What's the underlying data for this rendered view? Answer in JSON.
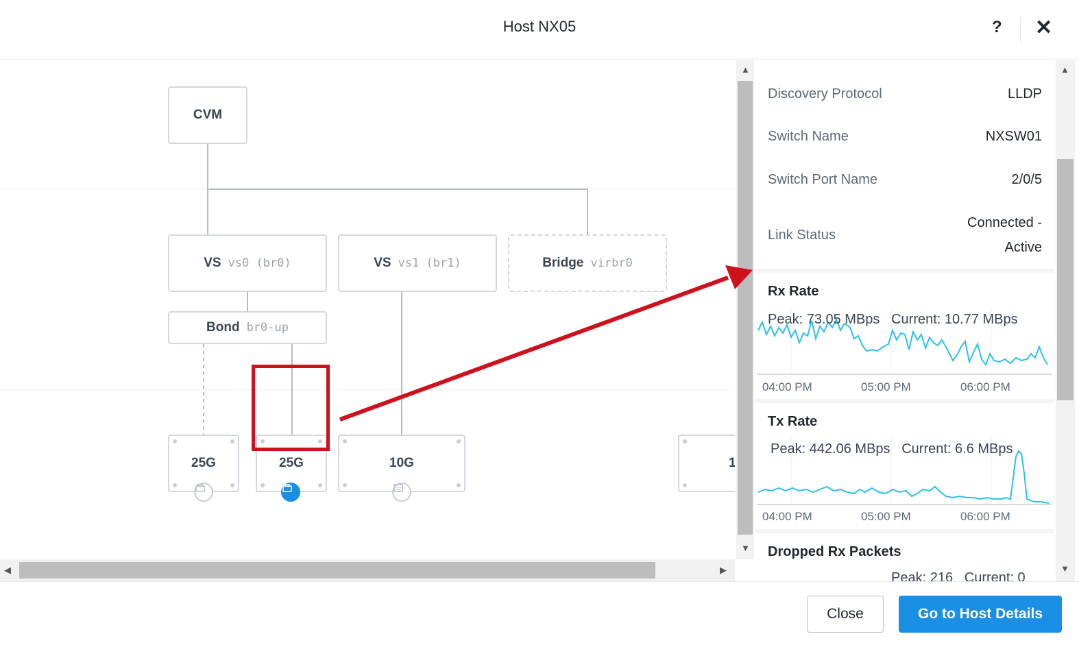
{
  "header": {
    "title": "Host NX05",
    "help_glyph": "?",
    "close_glyph": "✕"
  },
  "diagram": {
    "cvm": "CVM",
    "switches": [
      {
        "type": "VS",
        "name": "vs0 (br0)"
      },
      {
        "type": "VS",
        "name": "vs1 (br1)"
      },
      {
        "type": "Bridge",
        "name": "virbr0"
      }
    ],
    "bond": {
      "type": "Bond",
      "name": "br0-up"
    },
    "ports": [
      {
        "speed": "25G",
        "icon": "ethernet-icon",
        "active": false
      },
      {
        "speed": "25G",
        "icon": "ethernet-icon",
        "active": true
      },
      {
        "speed": "10G",
        "icon": "nic-icon",
        "active": false
      },
      {
        "speed": "1",
        "icon": "ethernet-icon",
        "active": false
      }
    ]
  },
  "details": {
    "rows": [
      {
        "label": "Discovery Protocol",
        "value": "LLDP"
      },
      {
        "label": "Switch Name",
        "value": "NXSW01"
      },
      {
        "label": "Switch Port Name",
        "value": "2/0/5"
      },
      {
        "label": "Link Status",
        "value_line1": "Connected -",
        "value_line2": "Active"
      }
    ],
    "charts": [
      {
        "title": "Rx Rate",
        "peak": "Peak: 73.05 MBps",
        "current": "Current: 10.77 MBps",
        "xticks": [
          "04:00 PM",
          "05:00 PM",
          "06:00 PM"
        ]
      },
      {
        "title": "Tx Rate",
        "peak": "Peak: 442.06 MBps",
        "current": "Current: 6.6 MBps",
        "xticks": [
          "04:00 PM",
          "05:00 PM",
          "06:00 PM"
        ]
      },
      {
        "title": "Dropped Rx Packets",
        "peak": "Peak: 216",
        "current": "Current: 0"
      }
    ]
  },
  "footer": {
    "close_label": "Close",
    "primary_label": "Go to Host Details"
  },
  "colors": {
    "accent": "#1a8fe6",
    "annotation": "#d0101c",
    "series": "#2bc0e4"
  }
}
